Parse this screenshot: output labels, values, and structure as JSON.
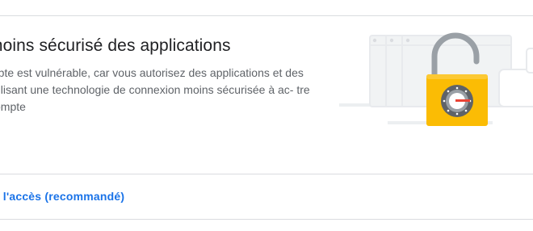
{
  "section": {
    "title": "moins sécurisé des applications",
    "description": "mpte est vulnérable, car vous autorisez des applications et des utilisant une technologie de connexion moins sécurisée à ac- tre compte",
    "link_short": "e",
    "action_link": "er l'accès (recommandé)"
  },
  "illustration": {
    "icon": "padlock-open-icon",
    "colors": {
      "lock_body": "#fbbc04",
      "lock_shackle": "#9aa0a6",
      "dial": "#5f6368",
      "window": "#f1f3f4",
      "accent": "#ea4335"
    }
  },
  "colors": {
    "link": "#1a73e8",
    "divider": "#dadce0",
    "text_primary": "#202124",
    "text_secondary": "#5f6368"
  }
}
